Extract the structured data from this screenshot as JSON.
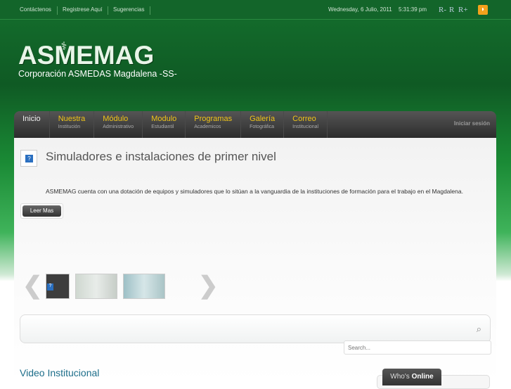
{
  "topbar": {
    "links": [
      "Contáctenos",
      "Registrese Aquí",
      "Sugerencias"
    ],
    "date": "Wednesday, 6 Julio, 2011",
    "time": "5:31:39 pm",
    "resize": [
      "R-",
      "R",
      "R+"
    ]
  },
  "logo": {
    "title": "ASMEMAG",
    "subtitle": "Corporación ASMEDAS Magdalena -SS-"
  },
  "nav": {
    "items": [
      {
        "title": "Inicio",
        "sub": ""
      },
      {
        "title": "Nuestra",
        "sub": "Institución"
      },
      {
        "title": "Módulo",
        "sub": "Administrativo"
      },
      {
        "title": "Modulo",
        "sub": "Estudiantil"
      },
      {
        "title": "Programas",
        "sub": "Academicos"
      },
      {
        "title": "Galería",
        "sub": "Fotográfica"
      },
      {
        "title": "Correo",
        "sub": "Institucional"
      }
    ],
    "login": "Iniciar sesión"
  },
  "slide": {
    "title": "Simuladores e instalaciones de primer nivel",
    "description": "ASMEMAG cuenta con una dotación de equipos y simuladores que lo sitúan a la vanguardia de la instituciones de formación para el trabajo en el Magdalena.",
    "more": "Leer Mas"
  },
  "search": {
    "placeholder": "Search..."
  },
  "video": {
    "title": "Video Institucional"
  },
  "online": {
    "who": "Who's",
    "online": "Online"
  }
}
